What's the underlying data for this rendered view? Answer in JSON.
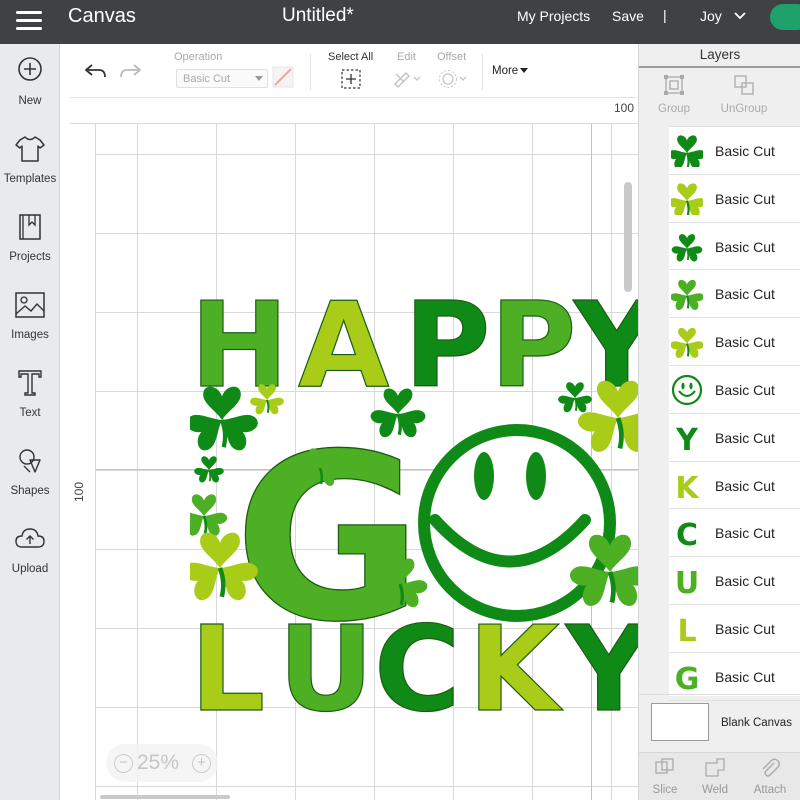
{
  "header": {
    "app_title": "Canvas",
    "doc_title": "Untitled*",
    "my_projects": "My Projects",
    "save": "Save",
    "separator": "|",
    "user": "Joy"
  },
  "sidebar": {
    "items": [
      {
        "label": "New",
        "icon": "plus-circle-icon"
      },
      {
        "label": "Templates",
        "icon": "shirt-icon"
      },
      {
        "label": "Projects",
        "icon": "bookmark-book-icon"
      },
      {
        "label": "Images",
        "icon": "image-icon"
      },
      {
        "label": "Text",
        "icon": "text-t-icon"
      },
      {
        "label": "Shapes",
        "icon": "shapes-icon"
      },
      {
        "label": "Upload",
        "icon": "cloud-upload-icon"
      }
    ]
  },
  "toolbar": {
    "operation_label": "Operation",
    "operation_value": "Basic Cut",
    "select_all": "Select All",
    "edit": "Edit",
    "offset": "Offset",
    "more": "More"
  },
  "canvas": {
    "ruler_top": "100",
    "ruler_left": "100",
    "zoom_minus": "−",
    "zoom_plus": "+",
    "zoom_value": "25%"
  },
  "design": {
    "line1": "HAPPY",
    "line2_left": "G",
    "line3": "LUCKY"
  },
  "colors": {
    "topbar": "#404143",
    "accent": "#1ea16b",
    "green_dark": "#0f8a16",
    "green_mid": "#4caf24",
    "green_light": "#a9cc18"
  },
  "layers_panel": {
    "title": "Layers",
    "group": "Group",
    "ungroup": "UnGroup",
    "items": [
      {
        "name": "Basic Cut",
        "thumb": "clover-dark-icon"
      },
      {
        "name": "Basic Cut",
        "thumb": "clover-light-icon"
      },
      {
        "name": "Basic Cut",
        "thumb": "clover-dark-icon"
      },
      {
        "name": "Basic Cut",
        "thumb": "clover-mid-icon"
      },
      {
        "name": "Basic Cut",
        "thumb": "clover-light-icon"
      },
      {
        "name": "Basic Cut",
        "thumb": "smiley-icon"
      },
      {
        "name": "Basic Cut",
        "thumb": "letter-y-icon",
        "letter": "Y"
      },
      {
        "name": "Basic Cut",
        "thumb": "letter-k-icon",
        "letter": "K"
      },
      {
        "name": "Basic Cut",
        "thumb": "letter-c-icon",
        "letter": "C"
      },
      {
        "name": "Basic Cut",
        "thumb": "letter-u-icon",
        "letter": "U"
      },
      {
        "name": "Basic Cut",
        "thumb": "letter-l-icon",
        "letter": "L"
      },
      {
        "name": "Basic Cut",
        "thumb": "letter-g-icon",
        "letter": "G"
      }
    ],
    "blank_canvas": "Blank Canvas",
    "slice": "Slice",
    "weld": "Weld",
    "attach": "Attach"
  }
}
